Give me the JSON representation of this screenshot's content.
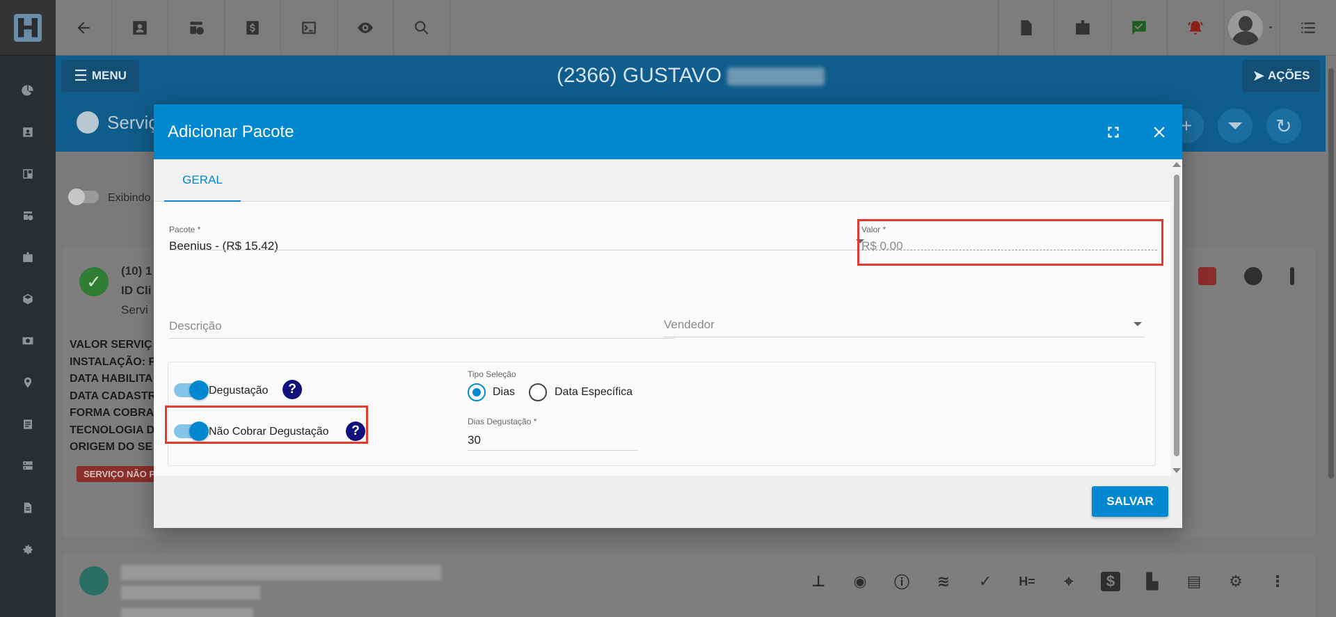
{
  "header": {
    "menu_label": "MENU",
    "client_title": "(2366) GUSTAVO",
    "actions_label": "AÇÕES",
    "page_title": "Serviç"
  },
  "background": {
    "toggle_label": "Exibindo",
    "card": {
      "line1": "(10) 1",
      "line2": "ID Cli",
      "line3": "Servi",
      "info": [
        "VALOR SERVIÇ",
        "INSTALAÇÃO: F",
        "DATA HABILITA",
        "DATA CADASTR",
        "FORMA COBRA",
        "TECNOLOGIA D",
        "ORIGEM DO SE"
      ],
      "badge": "SERVIÇO NÃO P"
    },
    "card2_dollar": "$",
    "card2_text_icon": "H="
  },
  "modal": {
    "title": "Adicionar Pacote",
    "tab": "GERAL",
    "pacote": {
      "label": "Pacote *",
      "value": "Beenius - (R$ 15.42)"
    },
    "valor": {
      "label": "Valor *",
      "placeholder": "R$ 0.00"
    },
    "descricao": {
      "placeholder": "Descrição"
    },
    "vendedor": {
      "placeholder": "Vendedor"
    },
    "degustacao": {
      "label": "Degustação",
      "enabled": true
    },
    "nao_cobrar": {
      "label": "Não Cobrar Degustação",
      "enabled": true
    },
    "help_symbol": "?",
    "tipo_selecao": {
      "label": "Tipo Seleção",
      "options": [
        "Dias",
        "Data Específica"
      ],
      "selected": "Dias"
    },
    "dias_degustacao": {
      "label": "Dias Degustação *",
      "value": "30"
    },
    "save_label": "SALVAR"
  },
  "colors": {
    "primary": "#0288d1",
    "highlight": "#e43a2b",
    "help": "#10117a"
  }
}
